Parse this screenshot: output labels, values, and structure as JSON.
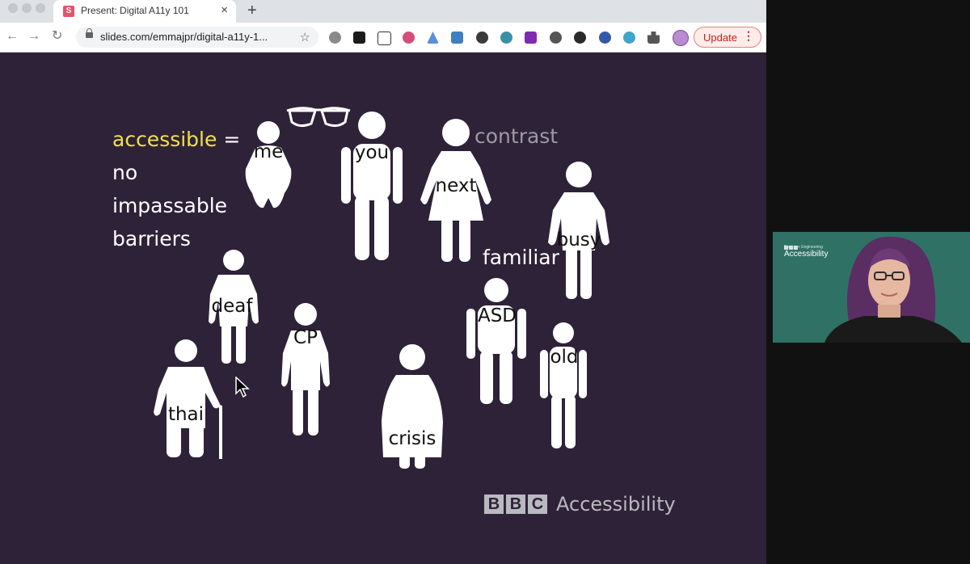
{
  "browser": {
    "tab": {
      "favicon": "S",
      "title": "Present: Digital A11y 101",
      "close": "×"
    },
    "new_tab": "+",
    "nav": {
      "back": "←",
      "forward": "→",
      "reload": "↻"
    },
    "url": "slides.com/emmajpr/digital-a11y-1...",
    "star": "☆",
    "update": {
      "label": "Update",
      "menu": "⋮"
    },
    "extensions": [
      "extension-icon-1",
      "extension-icon-2",
      "extension-icon-3",
      "extension-icon-4",
      "extension-icon-5",
      "extension-icon-6",
      "extension-icon-7",
      "extension-icon-8",
      "extension-icon-9",
      "extension-icon-10",
      "extension-icon-11",
      "extension-icon-12",
      "extension-icon-13",
      "puzzle-icon"
    ]
  },
  "slide": {
    "heading": {
      "accessible": "accessible",
      "equals": "=",
      "line2": "no",
      "line3": "impassable",
      "line4": "barriers"
    },
    "floating_words": {
      "contrast": "contrast",
      "familiar": "familiar"
    },
    "figures": {
      "me": "me",
      "you": "you",
      "next": "next",
      "busy": "busy",
      "deaf": "deaf",
      "cp": "CP",
      "asd": "ASD",
      "old": "old",
      "thai": "thai",
      "crisis": "crisis"
    },
    "footer": {
      "bbc_letters": [
        "B",
        "B",
        "C"
      ],
      "text": "Accessibility"
    },
    "colors": {
      "background": "#2e2238",
      "accent": "#f0e04a",
      "muted": "#b9b9c0"
    }
  },
  "webcam": {
    "logo_letters": [
      "B",
      "B",
      "C"
    ],
    "subtitle": "Design + Engineering",
    "title": "Accessibility",
    "background": "#2f7265"
  }
}
